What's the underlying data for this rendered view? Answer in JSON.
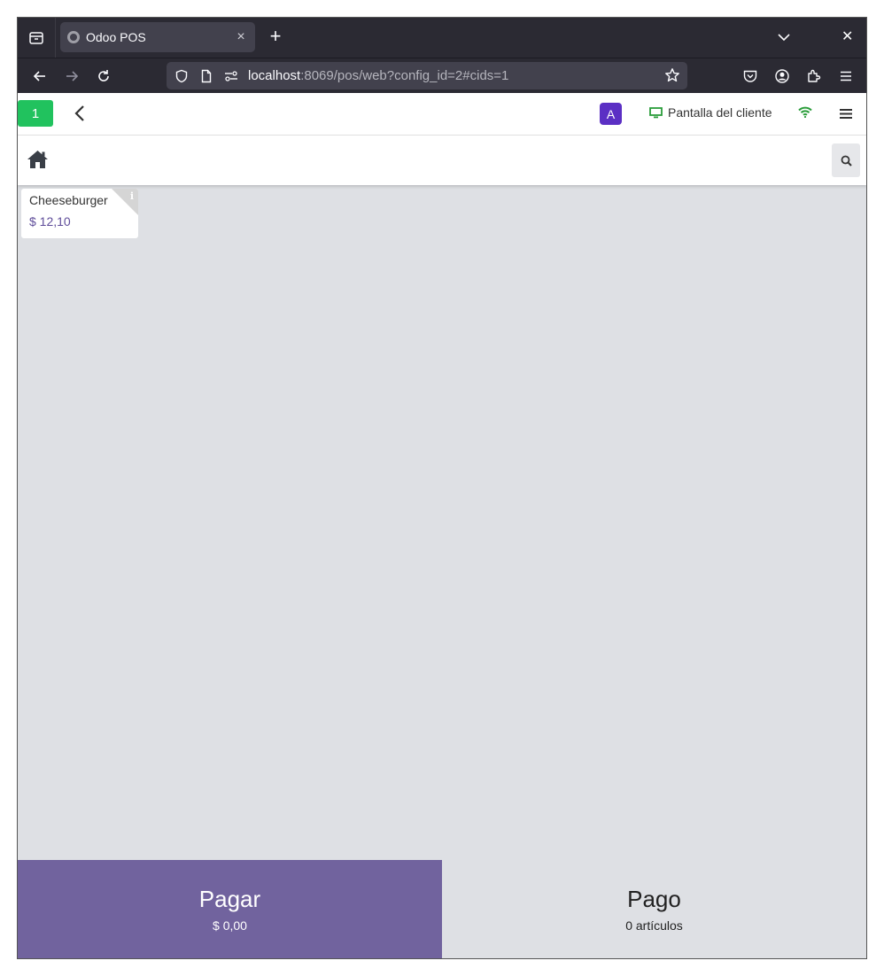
{
  "browser": {
    "tab_title": "Odoo POS",
    "tab_close": "×",
    "new_tab": "+",
    "window_close": "✕",
    "url_host": "localhost",
    "url_rest": ":8069/pos/web?config_id=2#cids=1"
  },
  "header": {
    "order_number": "1",
    "user_initial": "A",
    "customer_display_label": "Pantalla del cliente",
    "wifi_color": "#2a9d3a"
  },
  "products": [
    {
      "name": "Cheeseburger",
      "price": "$ 12,10",
      "info_icon": "i"
    }
  ],
  "footer": {
    "pay_label": "Pagar",
    "pay_amount": "$ 0,00",
    "review_label": "Pago",
    "review_count": "0 artículos"
  },
  "colors": {
    "accent": "#71639e",
    "order_badge": "#21c25e",
    "avatar": "#5b2fc4"
  }
}
